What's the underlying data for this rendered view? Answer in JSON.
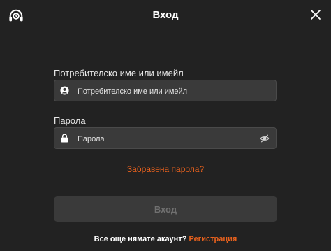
{
  "header": {
    "title": "Вход",
    "logo_icon": "headset-logo-icon",
    "close_icon": "close-icon"
  },
  "username": {
    "label": "Потребителско име или имейл",
    "placeholder": "Потребителско име или имейл",
    "value": "",
    "icon": "user-icon"
  },
  "password": {
    "label": "Парола",
    "placeholder": "Парола",
    "value": "",
    "icon": "lock-icon",
    "toggle_icon": "eye-slash-icon"
  },
  "forgot_link": "Забравена парола?",
  "submit_label": "Вход",
  "footer": {
    "question": "Все още нямате акаунт?",
    "register_link": "Регистрация"
  },
  "colors": {
    "background": "#222222",
    "field": "#3a3a3a",
    "accent": "#e8611d",
    "disabled_text": "#707070"
  }
}
